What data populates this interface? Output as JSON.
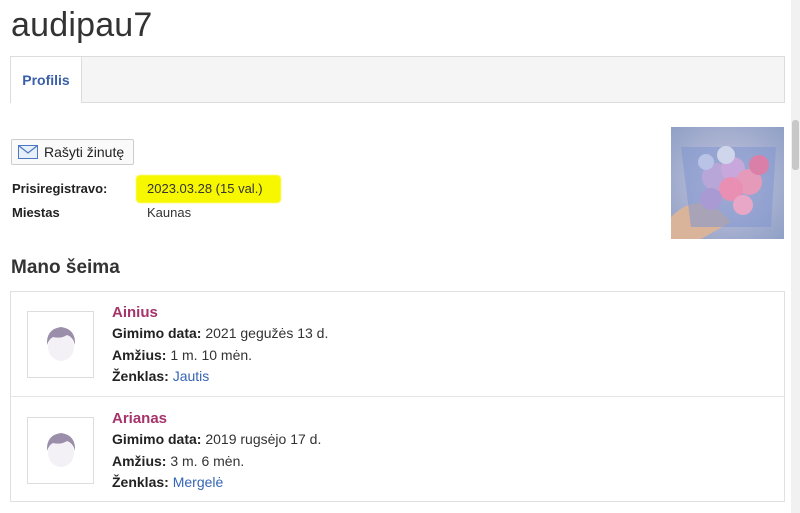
{
  "profile": {
    "username": "audipau7"
  },
  "tabs": [
    {
      "label": "Profilis"
    }
  ],
  "actions": {
    "message_label": "Rašyti žinutę"
  },
  "info": {
    "registered_label": "Prisiregistravo:",
    "registered_value": "2023.03.28 (15 val.)",
    "city_label": "Miestas",
    "city_value": "Kaunas"
  },
  "family": {
    "title": "Mano šeima",
    "children": [
      {
        "name": "Ainius",
        "birth_label": "Gimimo data:",
        "birth_value": "2021 gegužės 13 d.",
        "age_label": "Amžius:",
        "age_value": "1 m. 10 mėn.",
        "sign_label": "Ženklas:",
        "sign_value": "Jautis"
      },
      {
        "name": "Arianas",
        "birth_label": "Gimimo data:",
        "birth_value": "2019 rugsėjo 17 d.",
        "age_label": "Amžius:",
        "age_value": "3 m. 6 mėn.",
        "sign_label": "Ženklas:",
        "sign_value": "Mergelė"
      }
    ]
  },
  "colors": {
    "link": "#3566b5",
    "child_name": "#a5346a",
    "highlight": "#f7f700",
    "tab_active": "#3a5fa8"
  },
  "icons": {
    "message": "mail-icon",
    "child_avatar": "default-avatar-icon"
  }
}
